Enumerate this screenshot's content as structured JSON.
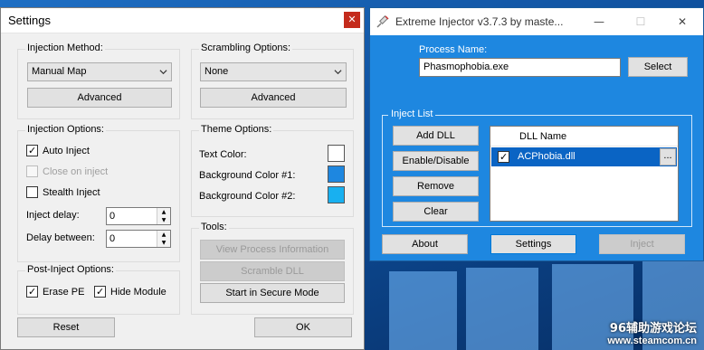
{
  "settings": {
    "title": "Settings",
    "injection_method": {
      "title": "Injection Method:",
      "value": "Manual Map",
      "advanced_label": "Advanced"
    },
    "scrambling": {
      "title": "Scrambling Options:",
      "value": "None",
      "advanced_label": "Advanced"
    },
    "injection_options": {
      "title": "Injection Options:",
      "auto_inject": {
        "label": "Auto Inject",
        "checked": true
      },
      "close_on_inject": {
        "label": "Close on inject",
        "checked": false,
        "disabled": true
      },
      "stealth_inject": {
        "label": "Stealth Inject",
        "checked": false
      },
      "inject_delay": {
        "label": "Inject delay:",
        "value": "0"
      },
      "delay_between": {
        "label": "Delay between:",
        "value": "0"
      }
    },
    "theme": {
      "title": "Theme Options:",
      "text_color": {
        "label": "Text Color:",
        "color": "#ffffff"
      },
      "bg1": {
        "label": "Background Color #1:",
        "color": "#1e87e0"
      },
      "bg2": {
        "label": "Background Color #2:",
        "color": "#18b0f0"
      }
    },
    "tools": {
      "title": "Tools:",
      "view_process": "View Process Information",
      "scramble_dll": "Scramble DLL",
      "secure_mode": "Start in Secure Mode"
    },
    "post_inject": {
      "title": "Post-Inject Options:",
      "erase_pe": {
        "label": "Erase PE",
        "checked": true
      },
      "hide_module": {
        "label": "Hide Module",
        "checked": true
      }
    },
    "reset_label": "Reset",
    "ok_label": "OK"
  },
  "injector": {
    "title": "Extreme Injector v3.7.3 by maste...",
    "process_name_label": "Process Name:",
    "process_name_value": "Phasmophobia.exe",
    "select_label": "Select",
    "inject_list": {
      "title": "Inject List",
      "add_dll": "Add DLL",
      "enable_disable": "Enable/Disable",
      "remove": "Remove",
      "clear": "Clear",
      "column_header": "DLL Name",
      "rows": [
        {
          "name": "ACPhobia.dll",
          "checked": true,
          "browse": "..."
        }
      ]
    },
    "about_label": "About",
    "settings_label": "Settings",
    "inject_label": "Inject"
  },
  "watermark": {
    "line1": "96辅助游戏论坛",
    "line2": "www.steamcom.cn"
  }
}
